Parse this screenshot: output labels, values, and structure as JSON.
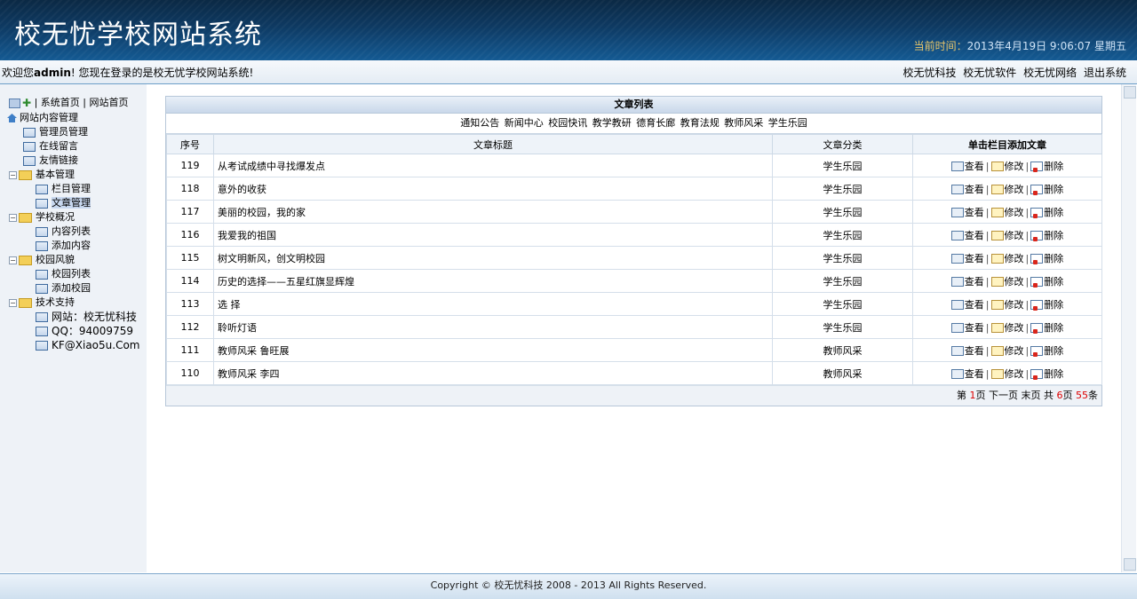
{
  "header": {
    "site_title": "校无忧学校网站系统",
    "datetime_label": "当前时间：",
    "datetime_value": "2013年4月19日 9:06:07 星期五"
  },
  "welcome": {
    "prefix": "欢迎您",
    "user": "admin",
    "suffix": "! 您现在登录的是校无忧学校网站系统!",
    "links": [
      "校无忧科技",
      "校无忧软件",
      "校无忧网络",
      "退出系统"
    ]
  },
  "sidebar": {
    "top_links": [
      "系统首页",
      "网站首页"
    ],
    "top_sep": "|",
    "root": "网站内容管理",
    "items": [
      {
        "label": "管理员管理",
        "type": "page",
        "level": 1
      },
      {
        "label": "在线留言",
        "type": "page",
        "level": 1
      },
      {
        "label": "友情链接",
        "type": "page",
        "level": 1
      },
      {
        "label": "基本管理",
        "type": "folder",
        "level": 1
      },
      {
        "label": "栏目管理",
        "type": "page",
        "level": 2
      },
      {
        "label": "文章管理",
        "type": "page",
        "level": 2
      },
      {
        "label": "学校概况",
        "type": "folder",
        "level": 1
      },
      {
        "label": "内容列表",
        "type": "page",
        "level": 2
      },
      {
        "label": "添加内容",
        "type": "page",
        "level": 2
      },
      {
        "label": "校园风貌",
        "type": "folder",
        "level": 1
      },
      {
        "label": "校园列表",
        "type": "page",
        "level": 2
      },
      {
        "label": "添加校园",
        "type": "page",
        "level": 2
      },
      {
        "label": "技术支持",
        "type": "folder",
        "level": 1
      },
      {
        "label": "网站：校无忧科技",
        "type": "page",
        "level": 2
      },
      {
        "label": "QQ：94009759",
        "type": "page",
        "level": 2
      },
      {
        "label": "KF@Xiao5u.Com",
        "type": "page",
        "level": 2
      }
    ]
  },
  "main": {
    "panel_title": "文章列表",
    "categories": [
      "通知公告",
      "新闻中心",
      "校园快讯",
      "教学教研",
      "德育长廊",
      "教育法规",
      "教师风采",
      "学生乐园"
    ],
    "columns": [
      "序号",
      "文章标题",
      "文章分类",
      "单击栏目添加文章"
    ],
    "actions": {
      "view": "查看",
      "edit": "修改",
      "delete": "删除",
      "sep": "|"
    },
    "rows": [
      {
        "id": "119",
        "title": "从考试成绩中寻找爆发点",
        "category": "学生乐园"
      },
      {
        "id": "118",
        "title": "意外的收获",
        "category": "学生乐园"
      },
      {
        "id": "117",
        "title": "美丽的校园，我的家",
        "category": "学生乐园"
      },
      {
        "id": "116",
        "title": "我爱我的祖国",
        "category": "学生乐园"
      },
      {
        "id": "115",
        "title": "树文明新风，创文明校园",
        "category": "学生乐园"
      },
      {
        "id": "114",
        "title": "历史的选择——五星红旗显辉煌",
        "category": "学生乐园"
      },
      {
        "id": "113",
        "title": "选 择",
        "category": "学生乐园"
      },
      {
        "id": "112",
        "title": "聆听灯语",
        "category": "学生乐园"
      },
      {
        "id": "111",
        "title": "教师风采 鲁旺展",
        "category": "教师风采"
      },
      {
        "id": "110",
        "title": "教师风采 李四",
        "category": "教师风采"
      }
    ],
    "pager": {
      "prefix": "第",
      "current": "1",
      "page_unit": "页",
      "next": "下一页",
      "last": "末页",
      "total_prefix": "共",
      "total_pages": "6",
      "total_count": "55",
      "count_unit": "条"
    }
  },
  "footer": {
    "copyright": "Copyright © 校无忧科技  2008 - 2013 All Rights Reserved."
  }
}
